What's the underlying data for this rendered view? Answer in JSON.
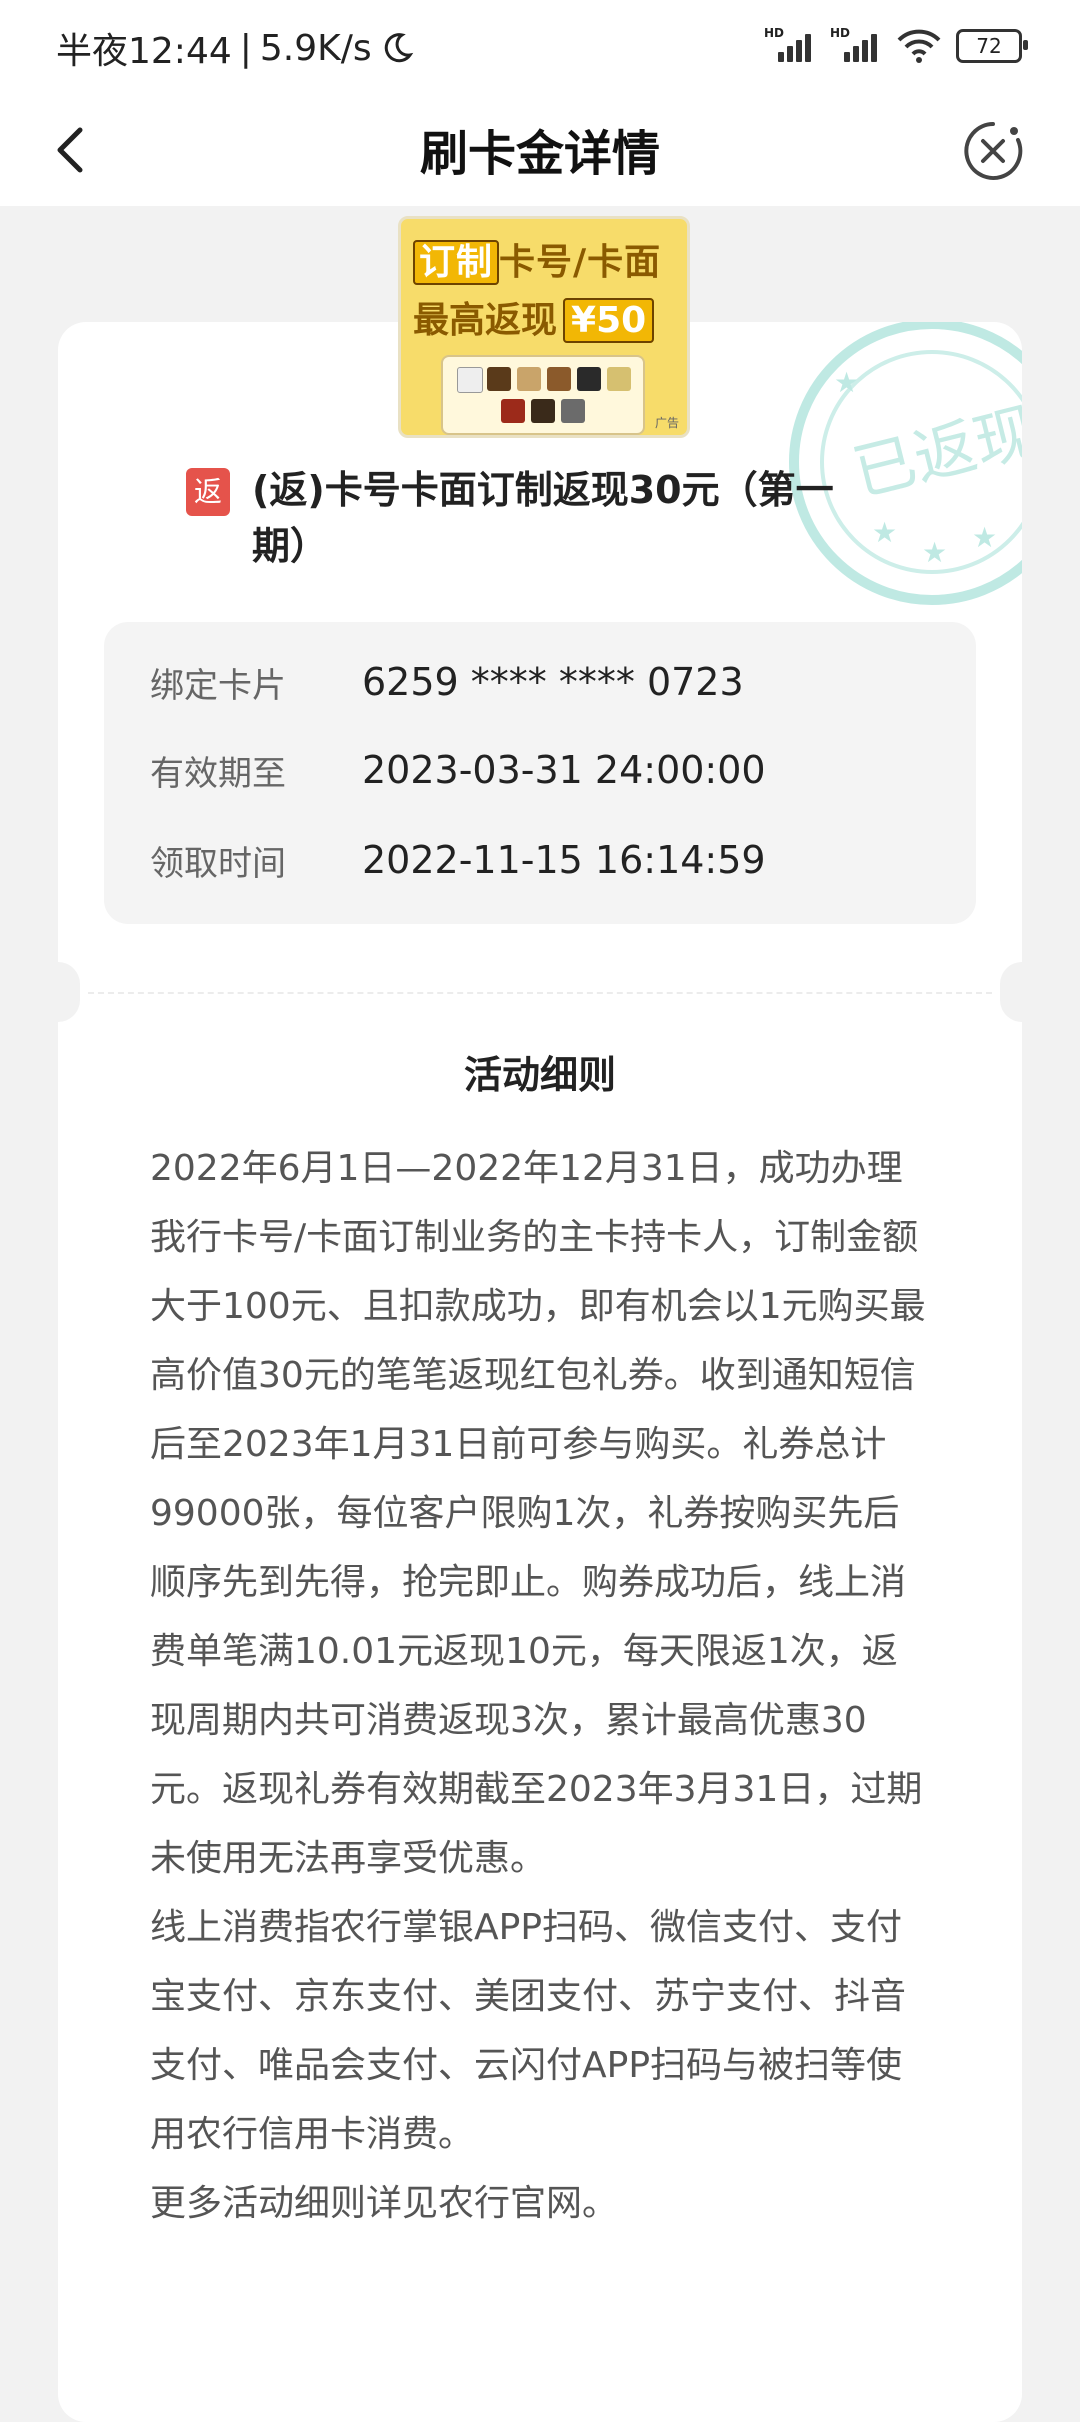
{
  "status_bar": {
    "time": "半夜12:44",
    "separator": "|",
    "speed": "5.9K/s",
    "signal1_label": "HD",
    "signal2_label": "HD",
    "battery": "72"
  },
  "navbar": {
    "title": "刷卡金详情",
    "back_icon": "chevron-left-icon",
    "close_icon": "close-circle-icon"
  },
  "ad": {
    "line1_highlight": "订制",
    "line1_rest": "卡号/卡面",
    "line2_text": "最高返现",
    "line2_price": "¥50",
    "tag": "广告"
  },
  "detail": {
    "badge": "返",
    "title": "(返)卡号卡面订制返现30元（第一期）",
    "stamp_text": "已返现",
    "rows": [
      {
        "label": "绑定卡片",
        "value": "6259 **** **** 0723"
      },
      {
        "label": "有效期至",
        "value": "2023-03-31 24:00:00"
      },
      {
        "label": "领取时间",
        "value": "2022-11-15 16:14:59"
      }
    ]
  },
  "rules": {
    "title": "活动细则",
    "paragraphs": [
      "2022年6月1日—2022年12月31日，成功办理我行卡号/卡面订制业务的主卡持卡人，订制金额大于100元、且扣款成功，即有机会以1元购买最高价值30元的笔笔返现红包礼券。收到通知短信后至2023年1月31日前可参与购买。礼券总计99000张，每位客户限购1次，礼券按购买先后顺序先到先得，抢完即止。购券成功后，线上消费单笔满10.01元返现10元，每天限返1次，返现周期内共可消费返现3次，累计最高优惠30元。返现礼券有效期截至2023年3月31日，过期未使用无法再享受优惠。",
      "线上消费指农行掌银APP扫码、微信支付、支付宝支付、京东支付、美团支付、苏宁支付、抖音支付、唯品会支付、云闪付APP扫码与被扫等使用农行信用卡消费。",
      "更多活动细则详见农行官网。"
    ]
  },
  "colors": {
    "background": "#f2f2f2",
    "badge_red": "#e5534b",
    "stamp_teal": "#8fd9cf"
  }
}
